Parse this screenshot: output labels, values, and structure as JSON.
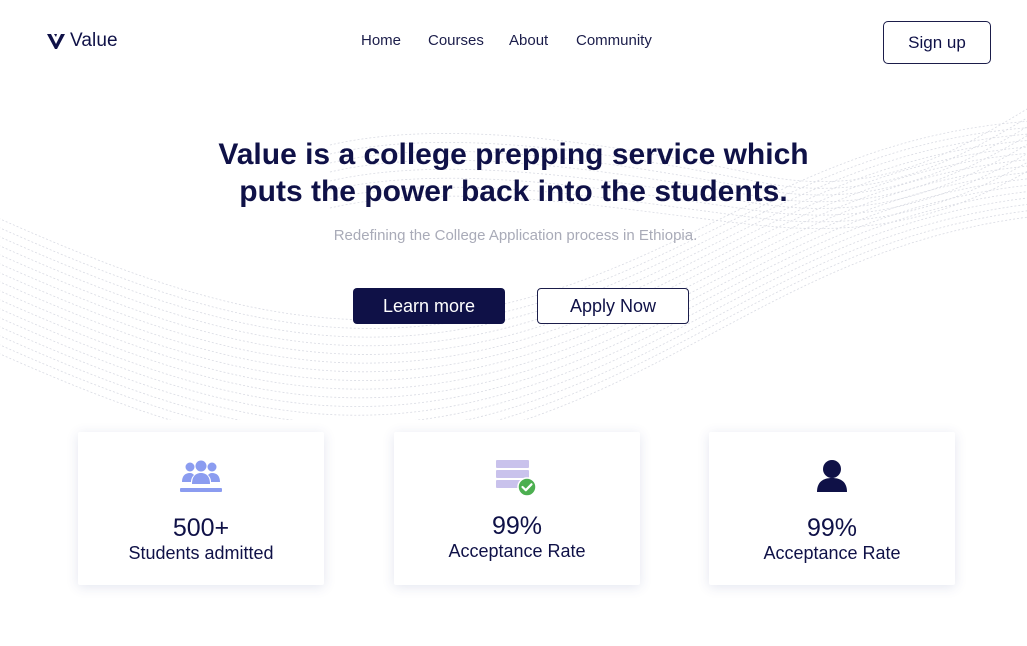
{
  "brand": {
    "name": "Value",
    "logo_icon": "v-logo-icon"
  },
  "nav": {
    "items": [
      {
        "label": "Home"
      },
      {
        "label": "Courses"
      },
      {
        "label": "About"
      },
      {
        "label": "Community"
      }
    ],
    "signup_label": "Sign up"
  },
  "hero": {
    "title_line1": "Value is a college prepping service which",
    "title_line2": "puts the power back into the students.",
    "subtitle": "Redefining the College Application process in Ethiopia.",
    "primary_button": "Learn more",
    "secondary_button": "Apply Now"
  },
  "stats": [
    {
      "icon": "group-icon",
      "value": "500+",
      "label": "Students admitted"
    },
    {
      "icon": "verified-list-icon",
      "value": "99%",
      "label": "Acceptance Rate"
    },
    {
      "icon": "person-icon",
      "value": "99%",
      "label": "Acceptance Rate"
    }
  ],
  "colors": {
    "navy": "#0f1147",
    "muted_text": "#a9abb8",
    "icon_blue": "#8b9cf0",
    "icon_lavender": "#c9c2ec",
    "check_green": "#4caf50",
    "wave_gray": "#d9dbe3"
  }
}
